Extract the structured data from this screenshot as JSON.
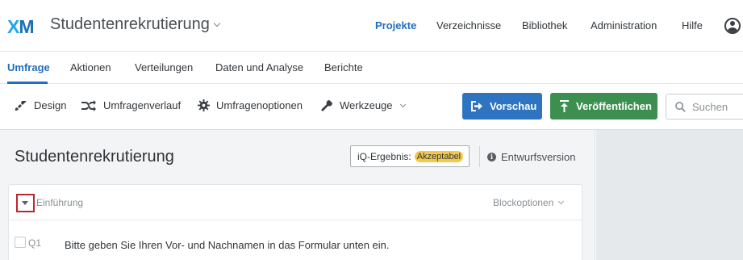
{
  "app": {
    "logo_x": "X",
    "logo_m": "M",
    "project_title": "Studentenrekrutierung"
  },
  "topnav": {
    "items": [
      "Projekte",
      "Verzeichnisse",
      "Bibliothek",
      "Administration",
      "Hilfe"
    ],
    "active": "Projekte"
  },
  "tabs": {
    "items": [
      "Umfrage",
      "Aktionen",
      "Verteilungen",
      "Daten und Analyse",
      "Berichte"
    ],
    "active": "Umfrage"
  },
  "toolbar": {
    "design": "Design",
    "flow": "Umfragenverlauf",
    "options": "Umfragenoptionen",
    "tools": "Werkzeuge",
    "preview": "Vorschau",
    "publish": "Veröffentlichen",
    "search_placeholder": "Suchen"
  },
  "survey": {
    "title": "Studentenrekrutierung",
    "iq_label": "iQ-Ergebnis:",
    "iq_value": "Akzeptabel",
    "version": "Entwurfsversion"
  },
  "block": {
    "name": "Einführung",
    "options_label": "Blockoptionen",
    "question_number": "Q1",
    "question_text": "Bitte geben Sie Ihren Vor- und Nachnamen in das Formular unten ein."
  },
  "colors": {
    "accent": "#1f6dbf",
    "preview_button": "#2f74c0",
    "publish_button": "#3d8f4f",
    "badge": "#f2c94c",
    "toggle_highlight": "#c0252e"
  }
}
